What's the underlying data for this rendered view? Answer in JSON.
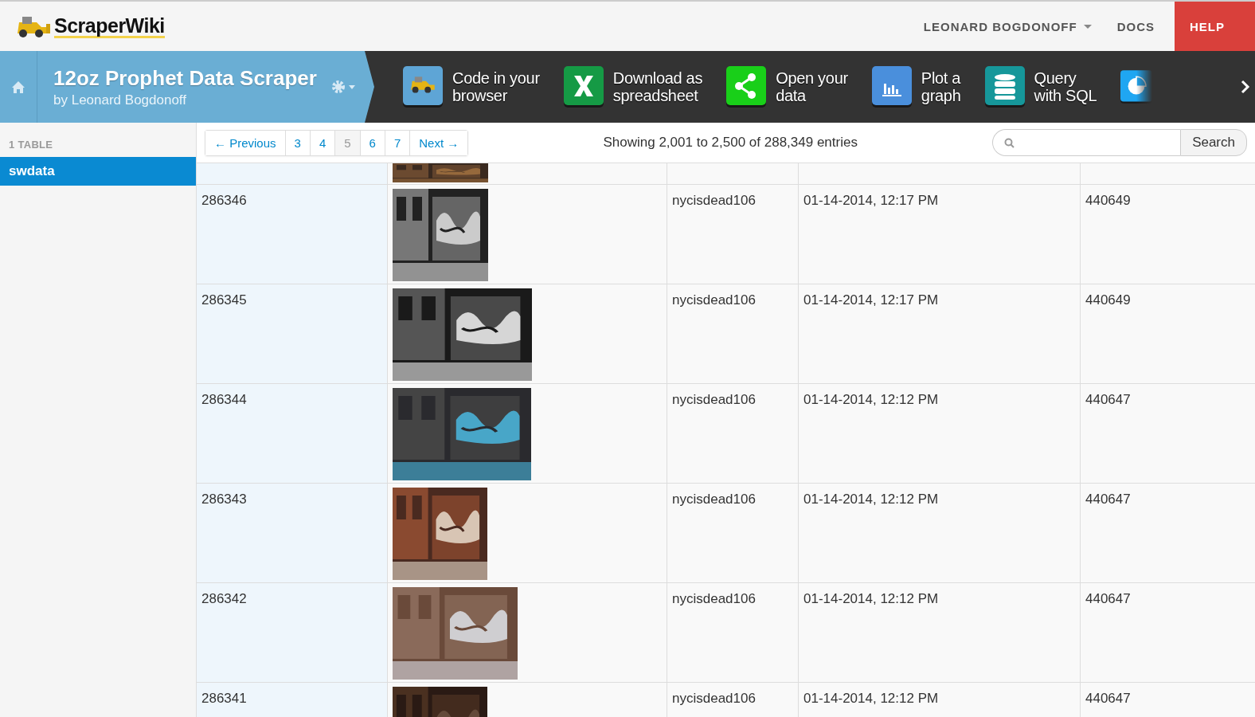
{
  "topbar": {
    "logo_text": "ScraperWiki",
    "user_menu": "LEONARD BOGDONOFF",
    "links": [
      {
        "label": "DOCS",
        "kind": "plain"
      },
      {
        "label": "HELP",
        "kind": "accent"
      }
    ]
  },
  "dataset": {
    "title": "12oz Prophet Data Scraper",
    "subtitle": "by Leonard Bogdonoff"
  },
  "tools": [
    {
      "kind": "code",
      "line1": "Code in your",
      "line2": "browser"
    },
    {
      "kind": "spreadsheet",
      "line1": "Download as",
      "line2": "spreadsheet"
    },
    {
      "kind": "share",
      "line1": "Open your",
      "line2": "data"
    },
    {
      "kind": "graph",
      "line1": "Plot a",
      "line2": "graph"
    },
    {
      "kind": "sql",
      "line1": "Query",
      "line2": "with SQL"
    },
    {
      "kind": "pie"
    }
  ],
  "sidebar": {
    "heading": "1 TABLE",
    "items": [
      {
        "label": "swdata",
        "selected": true
      }
    ]
  },
  "pagination": {
    "previous": "← Previous",
    "next": "Next →",
    "pages": [
      {
        "label": "3",
        "selected": false
      },
      {
        "label": "4",
        "selected": false
      },
      {
        "label": "5",
        "selected": true
      },
      {
        "label": "6",
        "selected": false
      },
      {
        "label": "7",
        "selected": false
      }
    ]
  },
  "status": "Showing 2,001 to 2,500 of 288,349 entries",
  "search": {
    "button": "Search"
  },
  "table": {
    "rows": [
      {
        "image": {
          "kind": "picture"
        }
      },
      {
        "id": "286346",
        "image": {
          "kind": "picture"
        },
        "user": "nycisdead106",
        "date": "01-14-2014, 12:17 PM",
        "column_5": "440649"
      },
      {
        "id": "286345",
        "image": {
          "kind": "picture"
        },
        "user": "nycisdead106",
        "date": "01-14-2014, 12:17 PM",
        "column_5": "440649"
      },
      {
        "id": "286344",
        "image": {
          "kind": "picture"
        },
        "user": "nycisdead106",
        "date": "01-14-2014, 12:12 PM",
        "column_5": "440647"
      },
      {
        "id": "286343",
        "image": {
          "kind": "picture"
        },
        "user": "nycisdead106",
        "date": "01-14-2014, 12:12 PM",
        "column_5": "440647"
      },
      {
        "id": "286342",
        "image": {
          "kind": "picture"
        },
        "user": "nycisdead106",
        "date": "01-14-2014, 12:12 PM",
        "column_5": "440647"
      },
      {
        "id": "286341",
        "image": {
          "kind": "picture"
        },
        "user": "nycisdead106",
        "date": "01-14-2014, 12:12 PM",
        "column_5": "440647"
      }
    ]
  }
}
